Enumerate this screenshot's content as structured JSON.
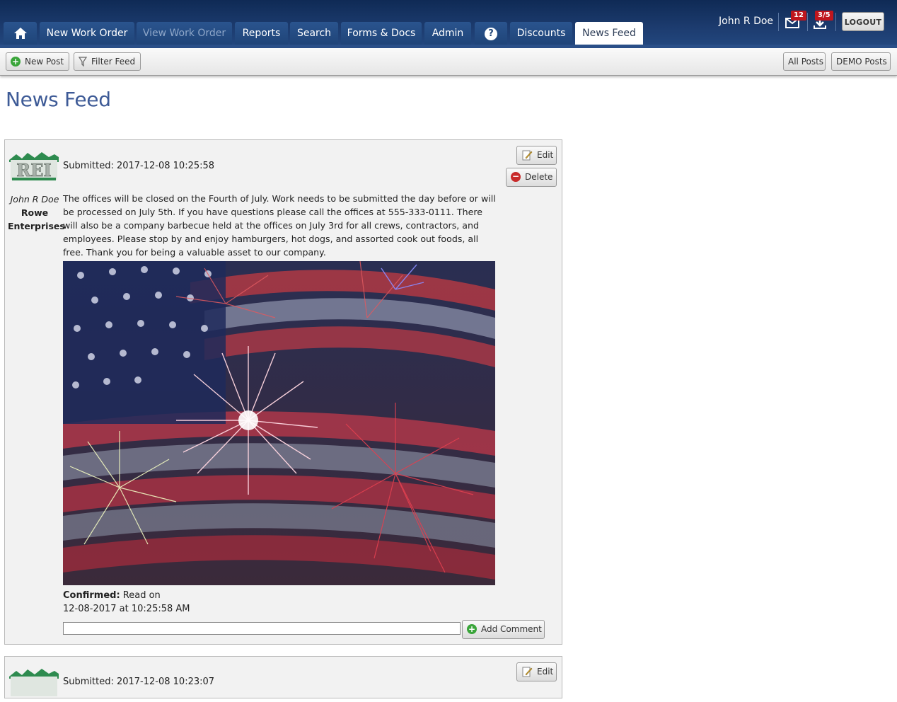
{
  "nav": {
    "tabs": [
      {
        "label": "New Work Order"
      },
      {
        "label": "View Work Order"
      },
      {
        "label": "Reports"
      },
      {
        "label": "Search"
      },
      {
        "label": "Forms & Docs"
      },
      {
        "label": "Admin"
      },
      {
        "label": "?"
      },
      {
        "label": "Discounts"
      },
      {
        "label": "News Feed"
      }
    ],
    "user_name": "John R Doe",
    "messages_badge": "12",
    "downloads_badge": "3/5",
    "logout_label": "LOGOUT"
  },
  "toolbar": {
    "new_post_label": "New Post",
    "filter_feed_label": "Filter Feed",
    "all_posts_label": "All Posts",
    "demo_posts_label": "DEMO Posts"
  },
  "page_title": "News Feed",
  "posts": [
    {
      "submitted": "Submitted: 2017-12-08 10:25:58",
      "author_name": "John R Doe",
      "company_line1": "Rowe",
      "company_line2": "Enterprises",
      "body": "The offices will be closed on the Fourth of July. Work needs to be submitted the day before or will be processed on July 5th. If you have questions please call the offices at 555-333-0111. There will also be a company barbecue held at the offices on July 3rd for all crews, contractors, and employees. Please stop by and enjoy hamburgers, hot dogs, and assorted cook out foods, all free. Thank you for being a valuable asset to our company.",
      "confirmed_label": "Confirmed:",
      "confirmed_text": "Read on",
      "confirmed_date": "12-08-2017 at 10:25:58 AM",
      "edit_label": "Edit",
      "delete_label": "Delete",
      "add_comment_label": "Add Comment",
      "comment_value": ""
    },
    {
      "submitted": "Submitted: 2017-12-08 10:23:07",
      "edit_label": "Edit"
    }
  ],
  "logo_text": "REI",
  "colors": {
    "nav_bg": "#1c3b6e",
    "title": "#3d5a96",
    "badge": "#c0161d"
  }
}
